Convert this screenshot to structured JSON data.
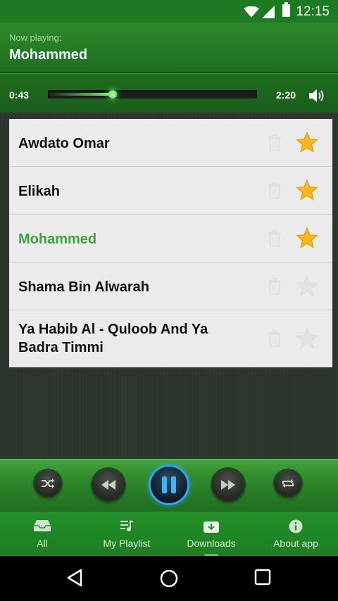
{
  "status_bar": {
    "time": "12:15"
  },
  "now_playing": {
    "label": "Now playing:",
    "title": "Mohammed"
  },
  "progress": {
    "current": "0:43",
    "total": "2:20",
    "fraction": 0.31
  },
  "playlist": [
    {
      "title": "Awdato Omar",
      "favorite": true,
      "playing": false
    },
    {
      "title": "Elikah",
      "favorite": true,
      "playing": false
    },
    {
      "title": "Mohammed",
      "favorite": true,
      "playing": true
    },
    {
      "title": "Shama Bin Alwarah",
      "favorite": false,
      "playing": false
    },
    {
      "title": "Ya Habib Al - Quloob And Ya Badra Timmi",
      "favorite": false,
      "playing": false
    }
  ],
  "controls": [
    "shuffle-icon",
    "rewind-icon",
    "pause-icon",
    "fast-forward-icon",
    "repeat-icon"
  ],
  "bottom_nav": [
    {
      "label": "All",
      "icon": "inbox-icon"
    },
    {
      "label": "My Playlist",
      "icon": "playlist-icon"
    },
    {
      "label": "Downloads",
      "icon": "download-box-icon",
      "active": true
    },
    {
      "label": "About app",
      "icon": "info-icon"
    }
  ],
  "colors": {
    "accent_green": "#2f8a2b",
    "playing_text": "#3aa33b",
    "star_gold": "#f7b91a",
    "pause_ring": "#2aa6ff"
  }
}
